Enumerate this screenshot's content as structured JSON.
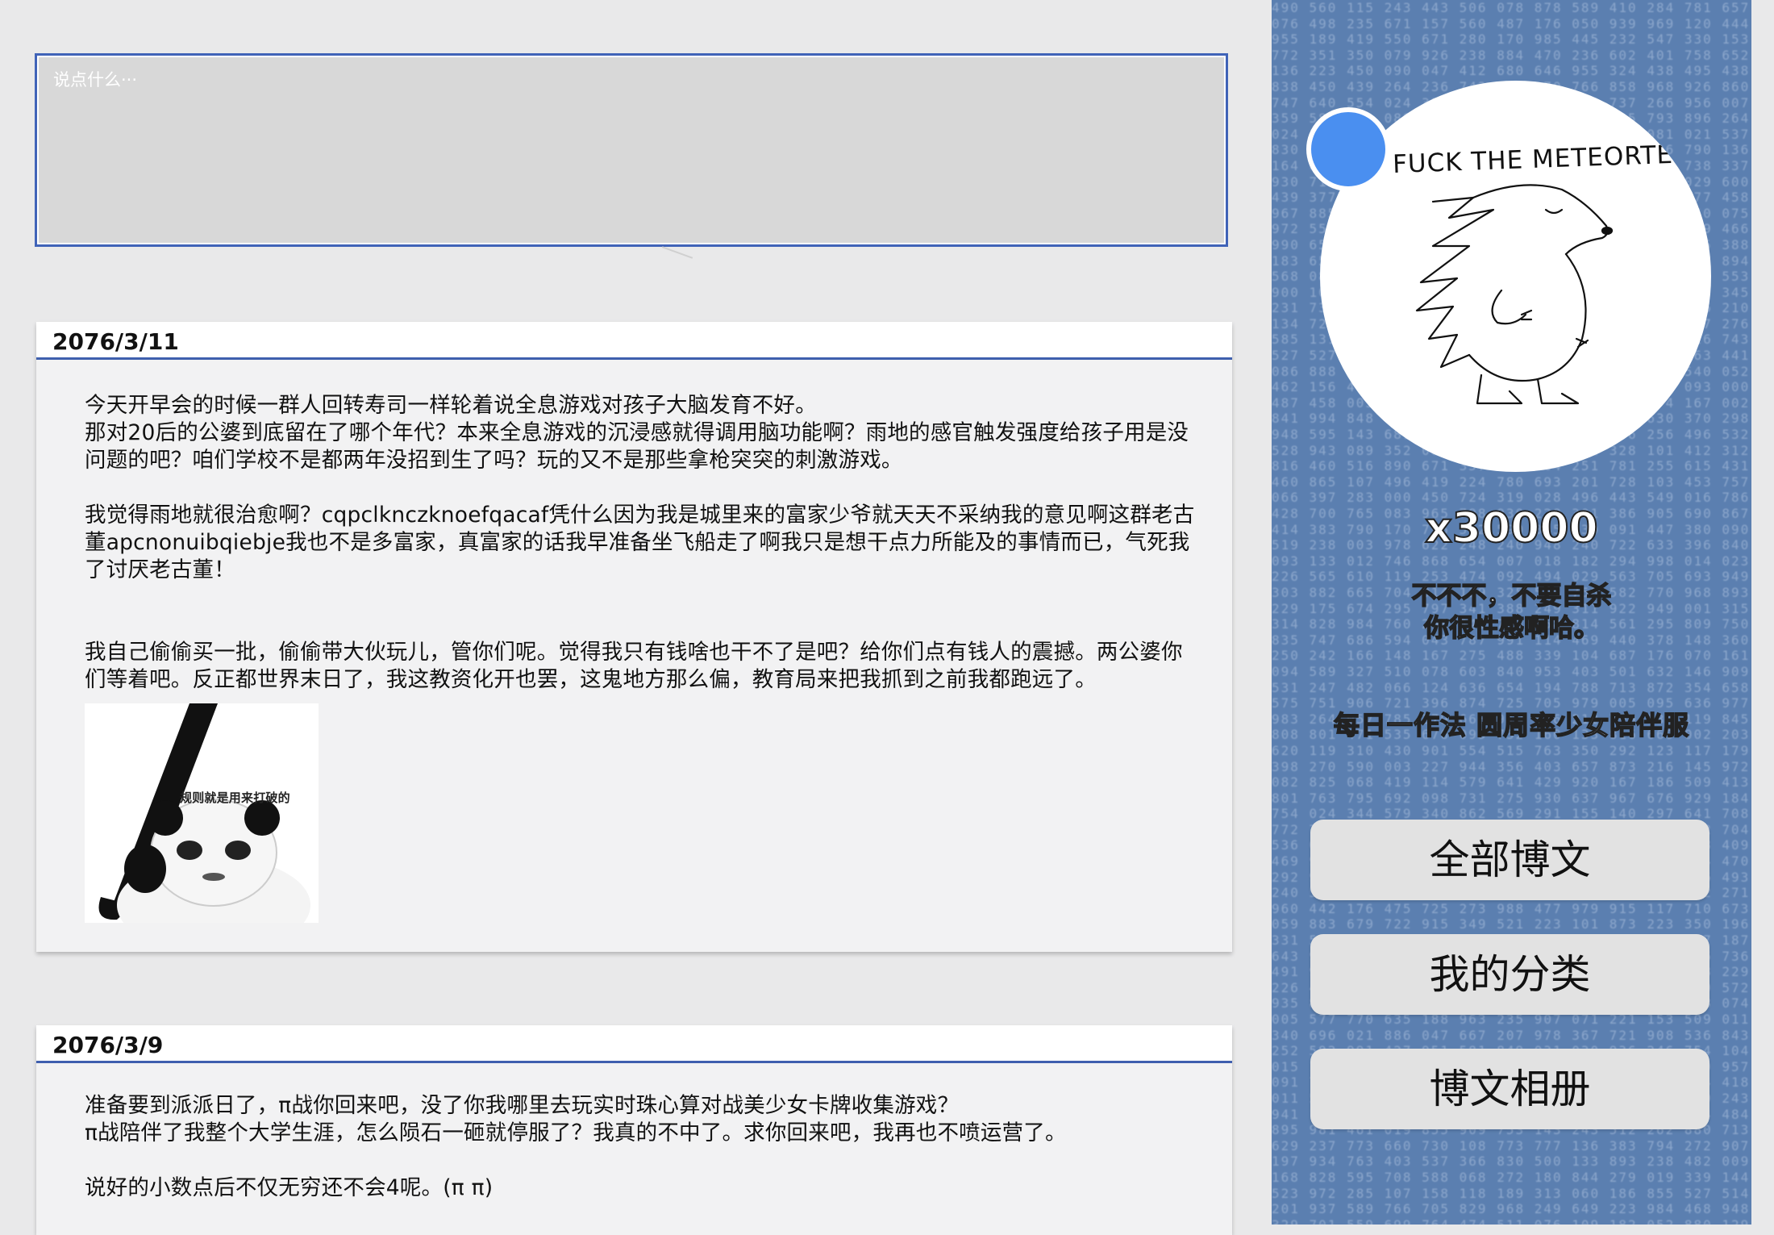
{
  "compose": {
    "placeholder": "说点什么···"
  },
  "posts": [
    {
      "date": "2076/3/11",
      "paragraphs": [
        "今天开早会的时候一群人回转寿司一样轮着说全息游戏对孩子大脑发育不好。",
        "那对20后的公婆到底留在了哪个年代？本来全息游戏的沉浸感就得调用脑功能啊？雨地的感官触发强度给孩子用是没问题的吧？咱们学校不是都两年没招到生了吗？玩的又不是那些拿枪突突的刺激游戏。",
        "我觉得雨地就很治愈啊？cqpclknczknoefqacaf凭什么因为我是城里来的富家少爷就天天不采纳我的意见啊这群老古董apcnonuibqiebje我也不是多富家，真富家的话我早准备坐飞船走了啊我只是想干点力所能及的事情而已，气死我了讨厌老古董！",
        "我自己偷偷买一批，偷偷带大伙玩儿，管你们呢。觉得我只有钱啥也干不了是吧？给你们点有钱人的震撼。两公婆你们等着吧。反正都世界末日了，我这教资化开也罢，这鬼地方那么偏，教育局来把我抓到之前我都跑远了。"
      ],
      "meme_caption": "规则就是用来打破的"
    },
    {
      "date": "2076/3/9",
      "paragraphs": [
        "准备要到派派日了，π战你回来吧，没了你我哪里去玩实时珠心算对战美少女卡牌收集游戏？",
        "π战陪伴了我整个大学生涯，怎么陨石一砸就停服了？我真的不中了。求你回来吧，我再也不喷运营了。",
        "说好的小数点后不仅无穷还不会4呢。(π π)"
      ]
    }
  ],
  "sidebar": {
    "avatar_caption": "FUCK THE METEORTE",
    "count": "x30000",
    "motto_line1": "不不不，不要自杀",
    "motto_line2": "你很性感啊哈。",
    "slogan": "每日一作法 圆周率少女陪伴服",
    "nav": [
      "全部博文",
      "我的分类",
      "博文相册"
    ]
  },
  "colors": {
    "accent": "#3f5fae",
    "sidebar_bg": "#5b7fb0",
    "status_dot": "#4a8ff0"
  }
}
